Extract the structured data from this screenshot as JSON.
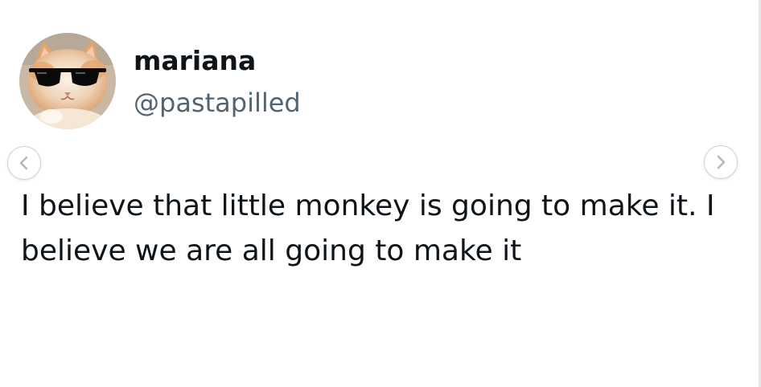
{
  "tweet": {
    "author": {
      "display_name": "mariana",
      "handle": "@pastapilled",
      "avatar_icon": "cat-wearing-sunglasses"
    },
    "text": "I believe that little monkey is going to make it. I believe we are all going to make it"
  },
  "carousel": {
    "prev_icon": "chevron-left-icon",
    "next_icon": "chevron-right-icon"
  },
  "colors": {
    "text_primary": "#0f1419",
    "text_secondary": "#536471",
    "background": "#ffffff"
  }
}
